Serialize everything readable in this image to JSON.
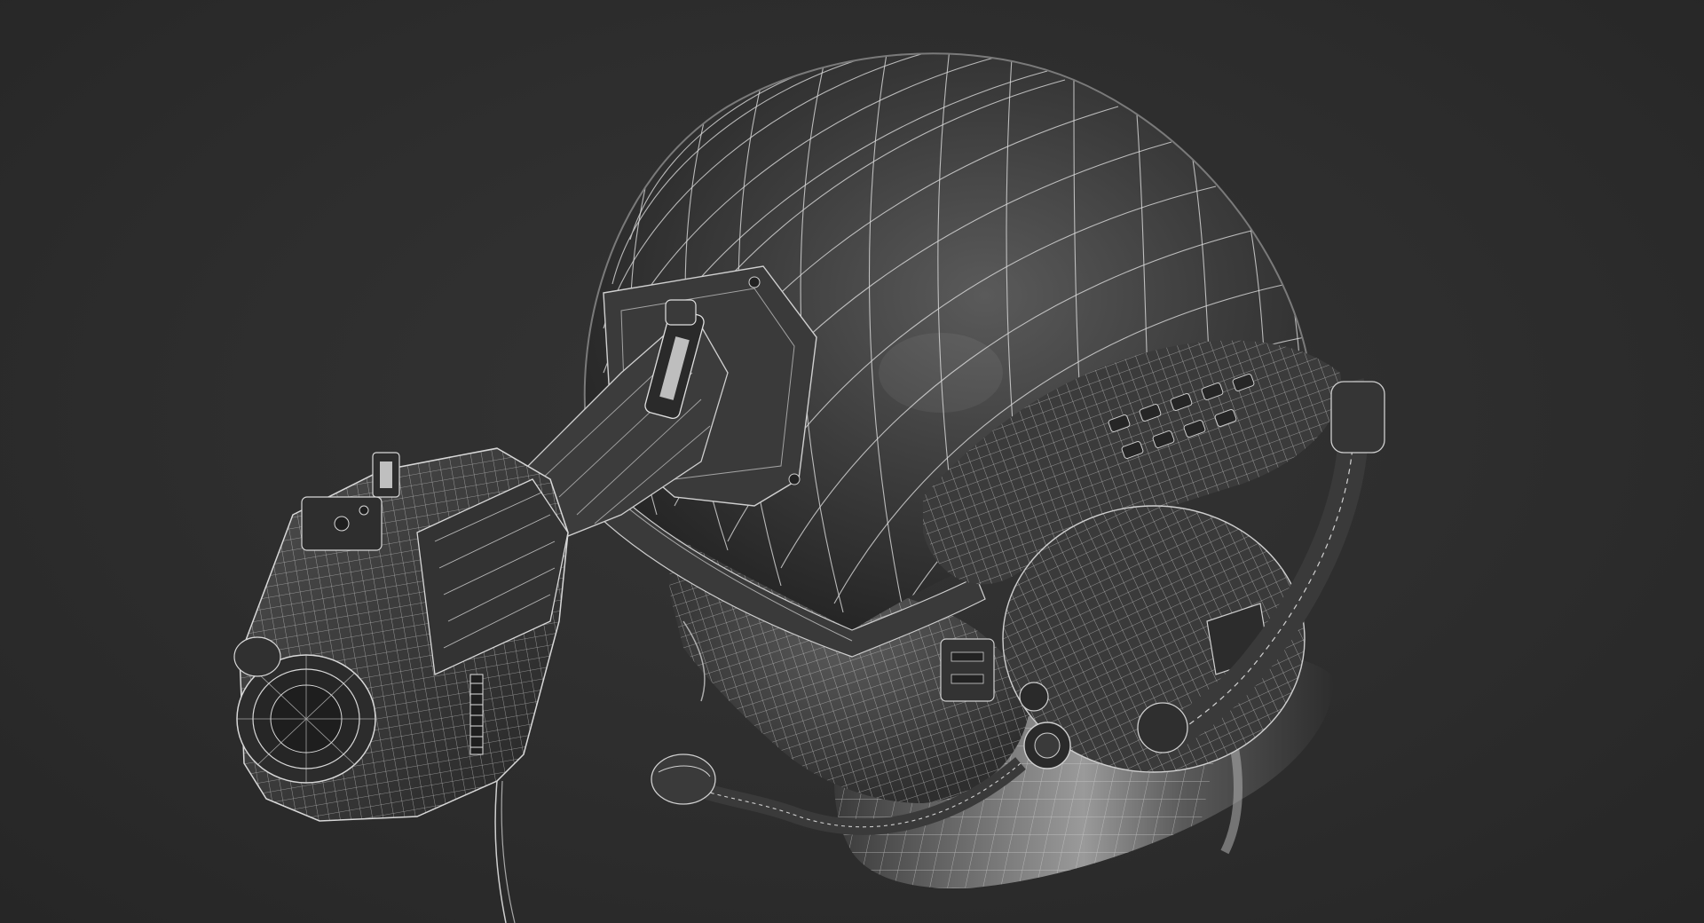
{
  "scene": {
    "subject": "wireframe-render",
    "background_color": "#2e2e2e",
    "mesh_line_color": "#d8d8d8",
    "surface_dark": "#2a2a2a",
    "surface_mid": "#4a4a4a",
    "surface_light": "#8a8a8a"
  }
}
